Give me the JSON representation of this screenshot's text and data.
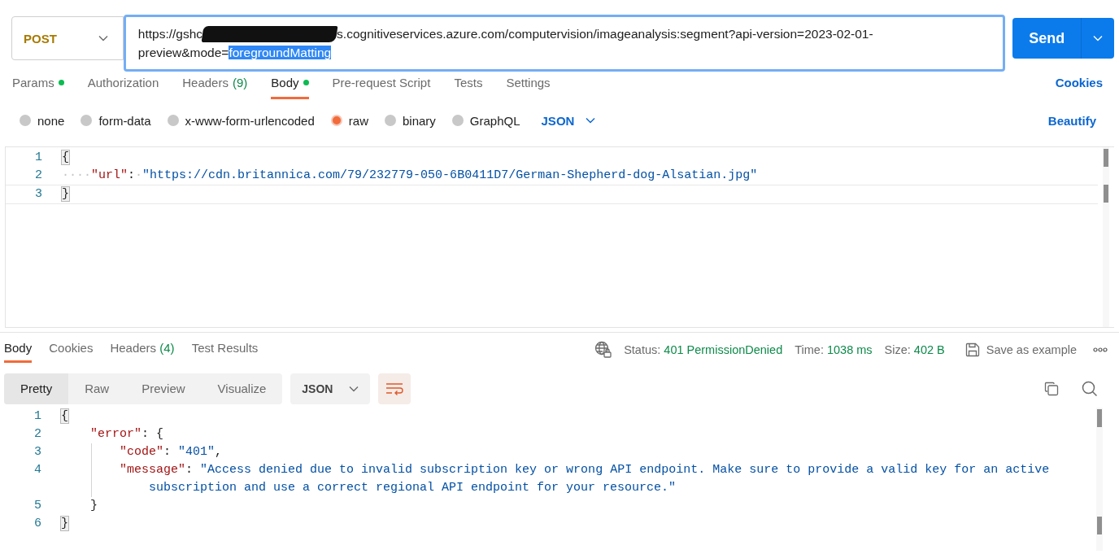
{
  "request": {
    "method": "POST",
    "url": {
      "before_redaction": "https://gshc",
      "redacted": true,
      "after_redaction": "s.cognitiveservices.azure.com/computervision/imageanalysis:segment?api-version=2023-02-01-preview&mode=",
      "selected_text": "foregroundMatting"
    },
    "send_label": "Send"
  },
  "request_tabs": [
    {
      "label": "Params",
      "dot": true,
      "selected": false
    },
    {
      "label": "Authorization",
      "dot": false,
      "selected": false
    },
    {
      "label": "Headers",
      "count": "(9)",
      "dot": false,
      "selected": false
    },
    {
      "label": "Body",
      "dot": true,
      "selected": true
    },
    {
      "label": "Pre-request Script",
      "dot": false,
      "selected": false
    },
    {
      "label": "Tests",
      "dot": false,
      "selected": false
    },
    {
      "label": "Settings",
      "dot": false,
      "selected": false
    }
  ],
  "cookies_link": "Cookies",
  "body_types": [
    {
      "label": "none",
      "selected": false
    },
    {
      "label": "form-data",
      "selected": false
    },
    {
      "label": "x-www-form-urlencoded",
      "selected": false
    },
    {
      "label": "raw",
      "selected": true
    },
    {
      "label": "binary",
      "selected": false
    },
    {
      "label": "GraphQL",
      "selected": false
    }
  ],
  "body_format": "JSON",
  "beautify_link": "Beautify",
  "request_body": [
    {
      "number": "1",
      "current": false,
      "guide": false,
      "tokens": [
        {
          "kind": "punct",
          "text": "{",
          "highlighted": true
        }
      ]
    },
    {
      "number": "2",
      "current": false,
      "guide": false,
      "tokens": [
        {
          "kind": "whitespace",
          "text": "····"
        },
        {
          "kind": "key",
          "text": "\"url\""
        },
        {
          "kind": "punct",
          "text": ":"
        },
        {
          "kind": "whitespace",
          "text": "·"
        },
        {
          "kind": "string",
          "text": "\"https://cdn.britannica.com/79/232779-050-6B0411D7/German-Shepherd-dog-Alsatian.jpg\""
        }
      ]
    },
    {
      "number": "3",
      "current": true,
      "guide": false,
      "tokens": [
        {
          "kind": "punct",
          "text": "}",
          "highlighted": true
        }
      ]
    }
  ],
  "response_tabs": [
    {
      "label": "Body",
      "selected": true
    },
    {
      "label": "Cookies",
      "selected": false
    },
    {
      "label": "Headers",
      "count": "(4)",
      "selected": false
    },
    {
      "label": "Test Results",
      "selected": false
    }
  ],
  "status": [
    {
      "label": "Status:",
      "value": "401 PermissionDenied"
    },
    {
      "label": "Time:",
      "value": "1038 ms"
    },
    {
      "label": "Size:",
      "value": "402 B"
    }
  ],
  "save_example": "Save as example",
  "view_modes": [
    {
      "label": "Pretty",
      "selected": true
    },
    {
      "label": "Raw",
      "selected": false
    },
    {
      "label": "Preview",
      "selected": false
    },
    {
      "label": "Visualize",
      "selected": false
    }
  ],
  "response_format": "JSON",
  "wrap_lines": true,
  "response_body": [
    {
      "number": "1",
      "current": false,
      "guide": false,
      "tokens": [
        {
          "kind": "punct",
          "text": "{",
          "highlighted": true
        }
      ]
    },
    {
      "number": "2",
      "current": false,
      "guide": false,
      "tokens": [
        {
          "kind": "key",
          "text": "    \"error\""
        },
        {
          "kind": "punct",
          "text": ": {"
        }
      ]
    },
    {
      "number": "3",
      "current": false,
      "guide": true,
      "tokens": [
        {
          "kind": "key",
          "text": "        \"code\""
        },
        {
          "kind": "punct",
          "text": ": "
        },
        {
          "kind": "string",
          "text": "\"401\""
        },
        {
          "kind": "punct",
          "text": ","
        }
      ]
    },
    {
      "number": "4",
      "current": false,
      "guide": true,
      "tokens": [
        {
          "kind": "key",
          "text": "        \"message\""
        },
        {
          "kind": "punct",
          "text": ": "
        },
        {
          "kind": "string",
          "text": "\"Access denied due to invalid subscription key or wrong API endpoint. Make sure to provide a valid key for an active subscription and use a correct regional API endpoint for your resource.\""
        }
      ]
    },
    {
      "number": "5",
      "current": false,
      "guide": false,
      "tokens": [
        {
          "kind": "punct",
          "text": "    }"
        }
      ]
    },
    {
      "number": "6",
      "current": false,
      "guide": false,
      "tokens": [
        {
          "kind": "punct",
          "text": "}",
          "highlighted": true
        }
      ]
    }
  ]
}
